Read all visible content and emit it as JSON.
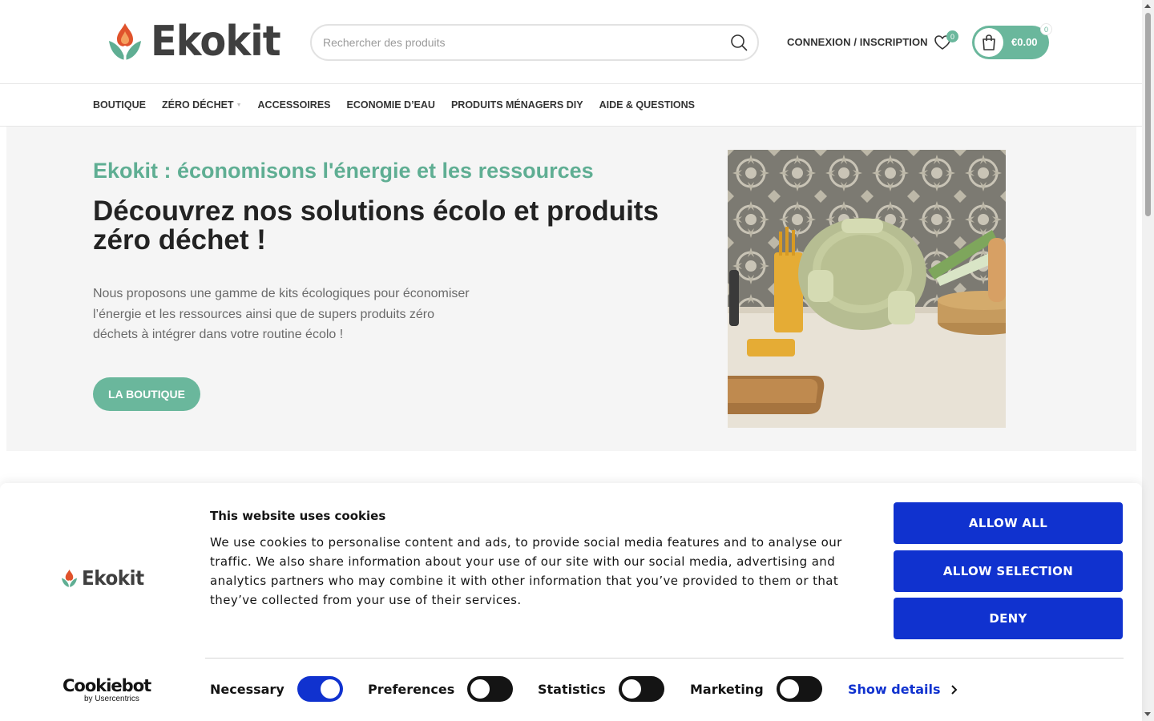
{
  "header": {
    "logo_text": "Ekokit",
    "search_placeholder": "Rechercher des produits",
    "login_label": "CONNEXION / INSCRIPTION",
    "wishlist_count": "0",
    "cart_total": "€0.00",
    "cart_count": "0"
  },
  "nav": {
    "items": [
      {
        "label": "BOUTIQUE"
      },
      {
        "label": "ZÉRO DÉCHET"
      },
      {
        "label": "ACCESSOIRES"
      },
      {
        "label": "ECONOMIE D’EAU"
      },
      {
        "label": "PRODUITS MÉNAGERS DIY"
      },
      {
        "label": "AIDE & QUESTIONS"
      }
    ]
  },
  "hero": {
    "kicker": "Ekokit : économisons l'énergie et les ressources",
    "title": "Découvrez nos solutions écolo et produits zéro déchet !",
    "text": "Nous proposons une gamme de kits écologiques pour économiser l’énergie et les ressources ainsi que de supers produits zéro déchets à intégrer dans votre routine écolo !",
    "button": "LA BOUTIQUE"
  },
  "cookie": {
    "logo_text": "Ekokit",
    "title": "This website uses cookies",
    "body": "We use cookies to personalise content and ads, to provide social media features and to analyse our traffic. We also share information about your use of our site with our social media, advertising and analytics partners who may combine it with other information that you’ve provided to them or that they’ve collected from your use of their services.",
    "allow_all": "ALLOW ALL",
    "allow_selection": "ALLOW SELECTION",
    "deny": "DENY",
    "provider_name": "Cookiebot",
    "provider_sub": "by Usercentrics",
    "options": [
      {
        "label": "Necessary",
        "enabled": true
      },
      {
        "label": "Preferences",
        "enabled": false
      },
      {
        "label": "Statistics",
        "enabled": false
      },
      {
        "label": "Marketing",
        "enabled": false
      }
    ],
    "show_details": "Show details"
  },
  "colors": {
    "brand_green": "#6ab79c",
    "cookie_blue": "#1032cf",
    "hero_bg": "#f5f5f5"
  }
}
